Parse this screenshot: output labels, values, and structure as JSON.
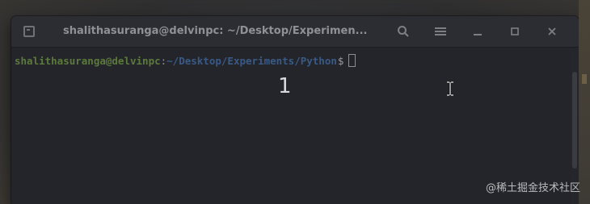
{
  "window": {
    "title": "shalithasuranga@delvinpc: ~/Desktop/Experimen...",
    "buttons": [
      "search",
      "menu",
      "minimize",
      "maximize",
      "close"
    ]
  },
  "terminal": {
    "user_host": "shalithasuranga@delvinpc",
    "colon": ":",
    "path": "~/Desktop/Experiments/Python",
    "dollar": "$"
  },
  "overlay": {
    "number": "1"
  },
  "watermark": "@稀土掘金技术社区",
  "colors": {
    "terminal_bg": "#23252b",
    "user_host": "#5c7a3a",
    "path": "#3a5a86"
  },
  "icons": [
    "new-tab-icon",
    "search-icon",
    "hamburger-menu-icon",
    "minimize-icon",
    "maximize-icon",
    "close-icon",
    "ibeam-cursor-icon"
  ]
}
